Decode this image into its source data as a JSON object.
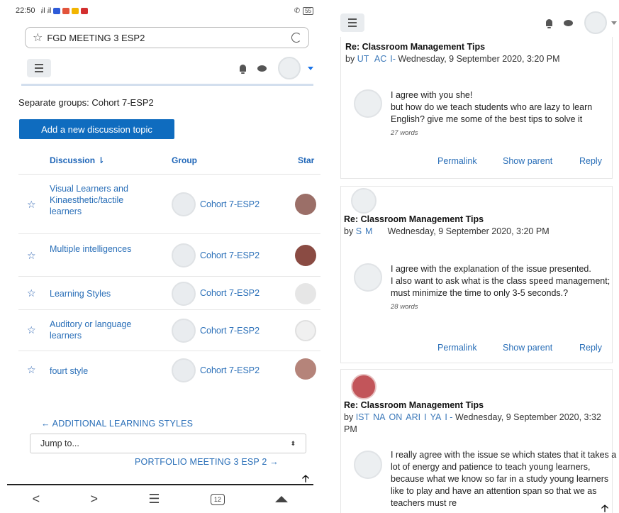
{
  "left": {
    "status": {
      "time": "22:50",
      "signal": "ᵢil ᵢil",
      "battery": "55"
    },
    "url": {
      "title": "FGD MEETING 3 ESP2"
    },
    "groups_label": "Separate groups: Cohort 7-ESP2",
    "add_button": "Add a new discussion topic",
    "table": {
      "headers": {
        "discussion": "Discussion ⇂",
        "group": "Group",
        "started": "Star"
      },
      "rows": [
        {
          "title": "Visual Learners and Kinaesthetic/tactile learners",
          "group": "Cohort 7-ESP2"
        },
        {
          "title": "Multiple intelligences",
          "group": "Cohort 7-ESP2"
        },
        {
          "title": "Learning Styles",
          "group": "Cohort 7-ESP2"
        },
        {
          "title": "Auditory or language learners",
          "group": "Cohort 7-ESP2"
        },
        {
          "title": "fourt style",
          "group": "Cohort 7-ESP2"
        }
      ]
    },
    "prev_link": "← ADDITIONAL LEARNING STYLES",
    "jump": {
      "value": "Jump to...",
      "arrow": "⬍"
    },
    "next_link": "PORTFOLIO MEETING 3 ESP 2 →",
    "bottom_nav": {
      "back": "<",
      "forward": ">",
      "menu": "☰",
      "tabs": "12"
    }
  },
  "right": {
    "posts": [
      {
        "title": "Re: Classroom Management Tips",
        "by": "by",
        "author": "UT   AC  I-",
        "date": "Wednesday, 9 September 2020, 3:20 PM",
        "reply_text": "I agree with you she!\nbut how do we teach students who are lazy to learn English? give me some of the best tips to solve it",
        "words": "27 words"
      },
      {
        "title": "Re: Classroom Management Tips",
        "by": "by",
        "author": "S  M       ",
        "date": "Wednesday, 9 September 2020, 3:20 PM",
        "reply_text": "I agree with the explanation of the issue presented.\nI also want to ask what is the class speed management; must minimize the time to only 3-5 seconds.?",
        "words": "28 words"
      },
      {
        "title": "Re: Classroom Management Tips",
        "by": "by",
        "author": "IST  NA  ON  ARI  I  YA  I -",
        "date": "Wednesday, 9 September 2020, 3:32 PM",
        "reply_text": "I really agree with the issue se   which states that it takes a lot of energy and patience to teach young learners, because what we know so far in a study young learners like to play and have an attention span so that we as teachers must re"
      }
    ],
    "actions": {
      "permalink": "Permalink",
      "show_parent": "Show parent",
      "reply": "Reply"
    }
  },
  "colors": {
    "primary_button": "#0f6cbf",
    "link": "#2a6fb8",
    "header_rule": "#d3dfee"
  },
  "icons": [
    "star-icon",
    "reload-icon",
    "hamburger-icon",
    "bell-icon",
    "chat-icon",
    "avatar-icon",
    "scroll-top-icon",
    "home-icon"
  ]
}
